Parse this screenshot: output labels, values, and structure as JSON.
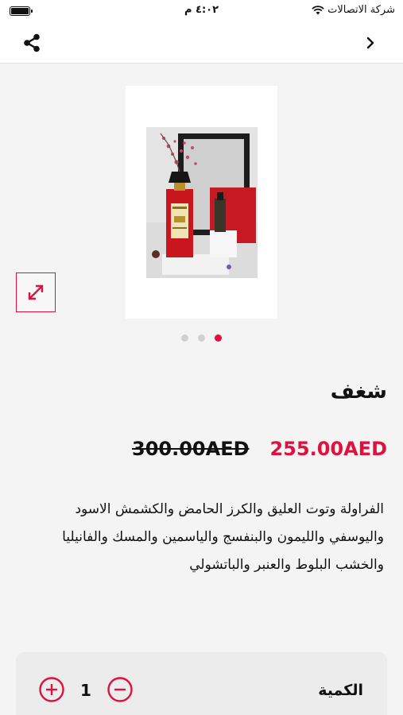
{
  "status_bar": {
    "carrier": "شركة الاتصالات",
    "time": "٤:٠٢ م"
  },
  "nav": {
    "share_icon": "share-icon",
    "back_icon": "chevron-right-icon"
  },
  "gallery": {
    "image_count": 3,
    "active_index": 2
  },
  "product": {
    "name": "شغف",
    "price": "255.00AED",
    "old_price": "300.00AED",
    "description_lines": [
      "الفراولة وتوت العليق والكرز الحامض والكشمش الاسود",
      "واليوسفي والليمون والبنفسج والياسمين والمسك والفانيليا",
      "والخشب البلوط والعنبر والباتشولي"
    ]
  },
  "quantity": {
    "label": "الكمية",
    "value": "1"
  },
  "colors": {
    "accent": "#e0113f",
    "background": "#f4f4f4"
  }
}
